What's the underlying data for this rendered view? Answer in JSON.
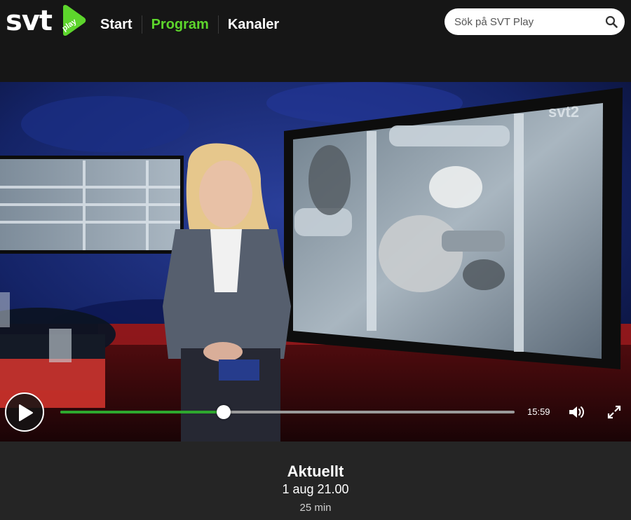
{
  "header": {
    "logo_text": "svt",
    "logo_badge": "play",
    "nav": [
      {
        "label": "Start",
        "active": false
      },
      {
        "label": "Program",
        "active": true
      },
      {
        "label": "Kanaler",
        "active": false
      }
    ],
    "search": {
      "placeholder": "Sök på SVT Play",
      "value": ""
    }
  },
  "player": {
    "channel_watermark": "svt2",
    "duration_label": "15:59",
    "progress_fraction": 0.36,
    "accent_color": "#2ea82e"
  },
  "program": {
    "title": "Aktuellt",
    "air_date": "1 aug 21.00",
    "length": "25 min"
  },
  "icons": {
    "play": "play-icon",
    "search": "search-icon",
    "volume": "volume-icon",
    "fullscreen": "fullscreen-icon"
  },
  "colors": {
    "brand_green": "#5dd52c",
    "background": "#161616",
    "info_panel": "#252525"
  }
}
